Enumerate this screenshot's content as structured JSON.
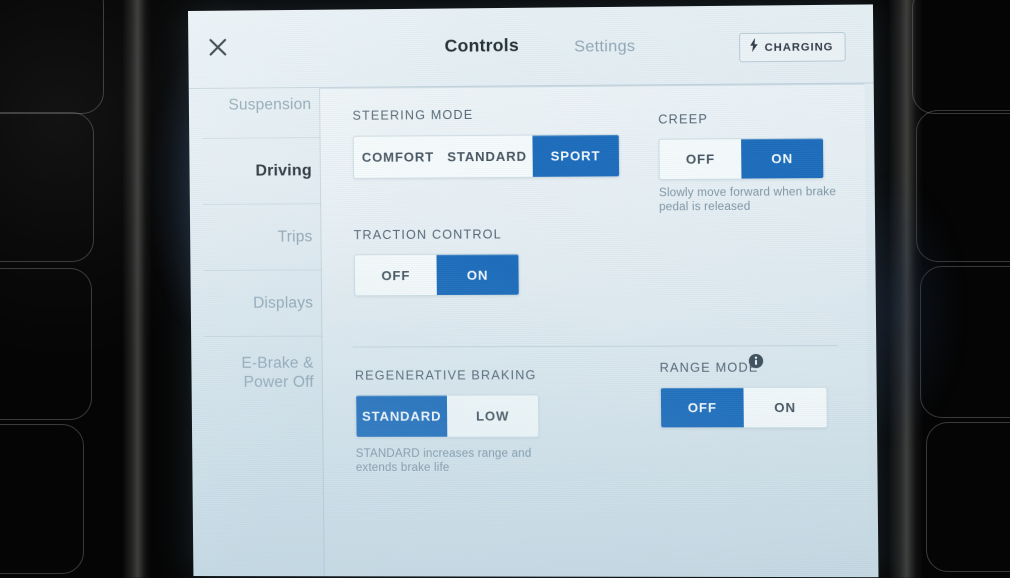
{
  "header": {
    "close_icon": "close-x-icon",
    "title": "Controls",
    "settings_tab": "Settings",
    "charging": {
      "icon": "lightning-bolt-icon",
      "label": "CHARGING"
    }
  },
  "sidebar": {
    "items": [
      {
        "label": "Suspension",
        "active": false
      },
      {
        "label": "Driving",
        "active": true
      },
      {
        "label": "Trips",
        "active": false
      },
      {
        "label": "Displays",
        "active": false
      },
      {
        "label": "E-Brake &\nPower Off",
        "active": false
      }
    ]
  },
  "content": {
    "steering_mode": {
      "label": "STEERING MODE",
      "options": [
        "COMFORT",
        "STANDARD",
        "SPORT"
      ],
      "selected": "SPORT"
    },
    "creep": {
      "label": "CREEP",
      "options": [
        "OFF",
        "ON"
      ],
      "selected": "ON",
      "caption": "Slowly move forward when brake\npedal is released"
    },
    "traction_control": {
      "label": "TRACTION CONTROL",
      "options": [
        "OFF",
        "ON"
      ],
      "selected": "ON"
    },
    "regenerative_braking": {
      "label": "REGENERATIVE BRAKING",
      "options": [
        "STANDARD",
        "LOW"
      ],
      "selected": "STANDARD",
      "caption": "STANDARD increases range and\nextends brake life"
    },
    "range_mode": {
      "label": "RANGE MODE",
      "info_icon": "info-circle-icon",
      "options": [
        "OFF",
        "ON"
      ],
      "selected": "OFF"
    }
  },
  "colors": {
    "accent_blue": "#1668b9",
    "screen_bg": "#dfeaf0",
    "text_dark": "#1d2830",
    "text_muted": "#8ba2b1"
  }
}
